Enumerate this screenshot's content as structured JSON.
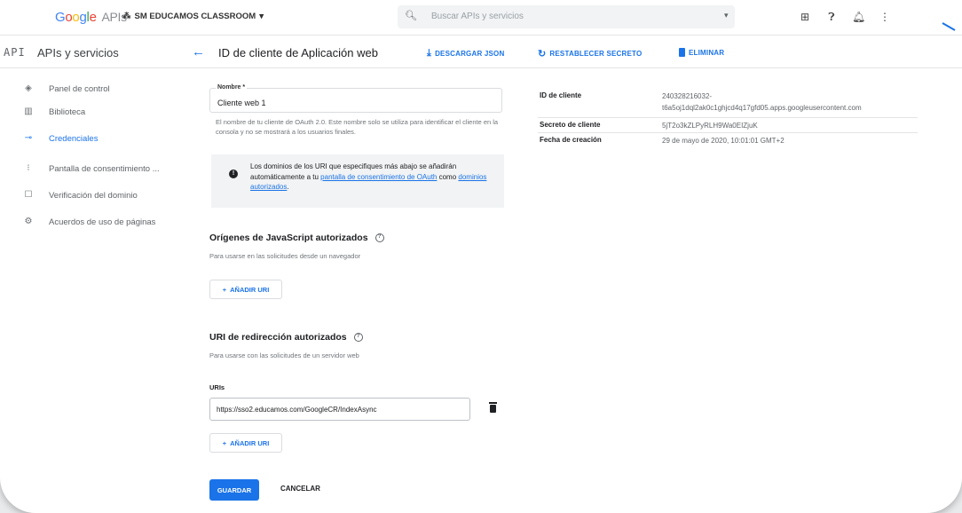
{
  "topbar": {
    "logo_google": [
      "G",
      "o",
      "o",
      "g",
      "l",
      "e"
    ],
    "logo_apis": "APIs",
    "project_name": "SM EDUCAMOS CLASSROOM",
    "search_placeholder": "Buscar APIs y servicios"
  },
  "subbar": {
    "api_mark": "API",
    "section_title": "APIs y servicios",
    "page_title": "ID de cliente de Aplicación web",
    "actions": {
      "download": "DESCARGAR JSON",
      "reset": "RESTABLECER SECRETO",
      "delete": "ELIMINAR"
    }
  },
  "sidebar": {
    "items": [
      {
        "label": "Panel de control",
        "icon": "dashboard-icon",
        "active": false
      },
      {
        "label": "Biblioteca",
        "icon": "library-icon",
        "active": false
      },
      {
        "label": "Credenciales",
        "icon": "key-icon",
        "active": true
      },
      {
        "label": "Pantalla de consentimiento ...",
        "icon": "consent-icon",
        "active": false
      },
      {
        "label": "Verificación del dominio",
        "icon": "checkbox-icon",
        "active": false
      },
      {
        "label": "Acuerdos de uso de páginas",
        "icon": "settings-list-icon",
        "active": false
      }
    ]
  },
  "form": {
    "name_label": "Nombre *",
    "name_value": "Cliente web 1",
    "name_helper": "El nombre de tu cliente de OAuth 2.0. Este nombre solo se utiliza para identificar el cliente en la consola y no se mostrará a los usuarios finales.",
    "info_prefix": "Los dominios de los URI que especifiques más abajo se añadirán automáticamente a tu",
    "info_link1": "pantalla de consentimiento de OAuth",
    "info_mid": "como",
    "info_link2": "dominios autorizados",
    "info_suffix": ".",
    "js_origins_title": "Orígenes de JavaScript autorizados",
    "js_origins_sub": "Para usarse en las solicitudes desde un navegador",
    "add_uri_label": "AÑADIR URI",
    "redirect_title": "URI de redirección autorizados",
    "redirect_sub": "Para usarse con las solicitudes de un servidor web",
    "uris_label": "URIs",
    "uri_value": "https://sso2.educamos.com/GoogleCR/IndexAsync",
    "save_label": "GUARDAR",
    "cancel_label": "CANCELAR"
  },
  "client_info": {
    "id_key": "ID de cliente",
    "id_value_1": "240328216032-",
    "id_value_2": "t6a5oj1dql2ak0c1ghjcd4q17gfd05.apps.googleusercontent.com",
    "secret_key": "Secreto de cliente",
    "secret_value": "5jT2o3kZLPyRLH9Wa0EIZjuK",
    "created_key": "Fecha de creación",
    "created_value": "29 de mayo de 2020, 10:01:01 GMT+2"
  },
  "colors": {
    "accent": "#1a73e8"
  }
}
